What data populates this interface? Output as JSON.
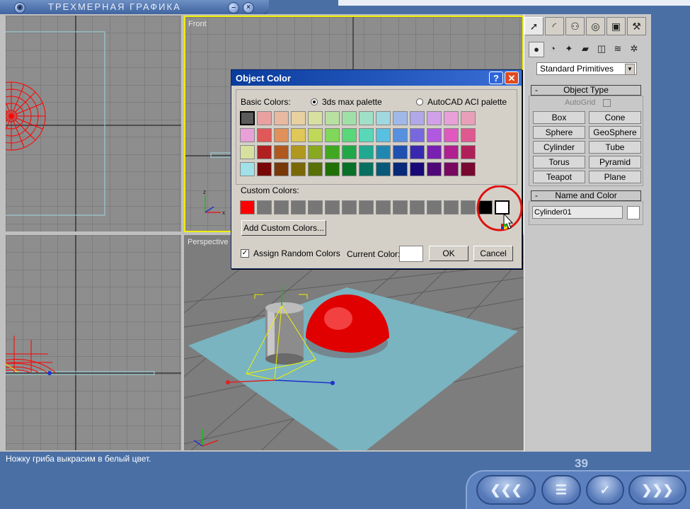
{
  "app": {
    "title": "ТРЕХМЕРНАЯ ГРАФИКА",
    "page_number": "39",
    "status_text": "Ножку гриба выкрасим в белый цвет."
  },
  "viewports": {
    "front_label": "Front",
    "perspective_label": "Perspective"
  },
  "command_panel": {
    "tabs": [
      "create-icon",
      "modify-icon",
      "hierarchy-icon",
      "motion-icon",
      "display-icon",
      "utilities-icon"
    ],
    "categories": [
      "geometry-icon",
      "shapes-icon",
      "lights-icon",
      "cameras-icon",
      "helpers-icon",
      "spacewarps-icon",
      "systems-icon"
    ],
    "dropdown_value": "Standard Primitives",
    "object_type": {
      "header": "Object Type",
      "autogrid_label": "AutoGrid",
      "buttons": [
        "Box",
        "Cone",
        "Sphere",
        "GeoSphere",
        "Cylinder",
        "Tube",
        "Torus",
        "Pyramid",
        "Teapot",
        "Plane"
      ]
    },
    "name_color": {
      "header": "Name and Color",
      "name_value": "Cylinder01",
      "color": "#ffffff"
    }
  },
  "dialog": {
    "title": "Object Color",
    "help_label": "?",
    "close_label": "✕",
    "basic_colors_label": "Basic Colors:",
    "radio_3ds": "3ds max palette",
    "radio_acad": "AutoCAD ACI palette",
    "custom_colors_label": "Custom Colors:",
    "add_custom_label": "Add Custom Colors...",
    "assign_random_label": "Assign Random Colors",
    "current_color_label": "Current Color:",
    "current_color": "#ffffff",
    "ok_label": "OK",
    "cancel_label": "Cancel",
    "basic_palette": [
      [
        "#5a5a5a",
        "#e8a0a0",
        "#e8b8a0",
        "#e8d0a0",
        "#d8e0a0",
        "#b8e0a0",
        "#a0e0a8",
        "#a0e0c8",
        "#a0d8e0",
        "#a0b8e8",
        "#b0a8e8",
        "#d0a0e8",
        "#e8a0d8",
        "#e8a0b8"
      ],
      [
        "#e8a0d8",
        "#e05858",
        "#e09058",
        "#e0c858",
        "#c0d858",
        "#80d858",
        "#58d878",
        "#58d8b8",
        "#58c0e0",
        "#5890e0",
        "#7868e0",
        "#b058e0",
        "#e058c0",
        "#e05890"
      ],
      [
        "#d8e0a0",
        "#b02020",
        "#b05820",
        "#b09820",
        "#88a820",
        "#40a820",
        "#20a848",
        "#20a890",
        "#2088b0",
        "#2050b0",
        "#3828b0",
        "#7820b0",
        "#b02090",
        "#b02058"
      ],
      [
        "#a0e0e8",
        "#780808",
        "#783808",
        "#786808",
        "#587008",
        "#207008",
        "#087028",
        "#087060",
        "#085878",
        "#082878",
        "#180878",
        "#500878",
        "#780860",
        "#780830"
      ]
    ],
    "custom_palette": [
      "#ff0000",
      "#777777",
      "#777777",
      "#777777",
      "#777777",
      "#777777",
      "#777777",
      "#777777",
      "#777777",
      "#777777",
      "#777777",
      "#777777",
      "#777777",
      "#777777",
      "#000000",
      "#ffffff"
    ]
  },
  "nav": {
    "back_icon": "double-chevron-left-icon",
    "menu_icon": "menu-list-icon",
    "check_icon": "checkmark-icon",
    "forward_icon": "double-chevron-right-icon"
  }
}
